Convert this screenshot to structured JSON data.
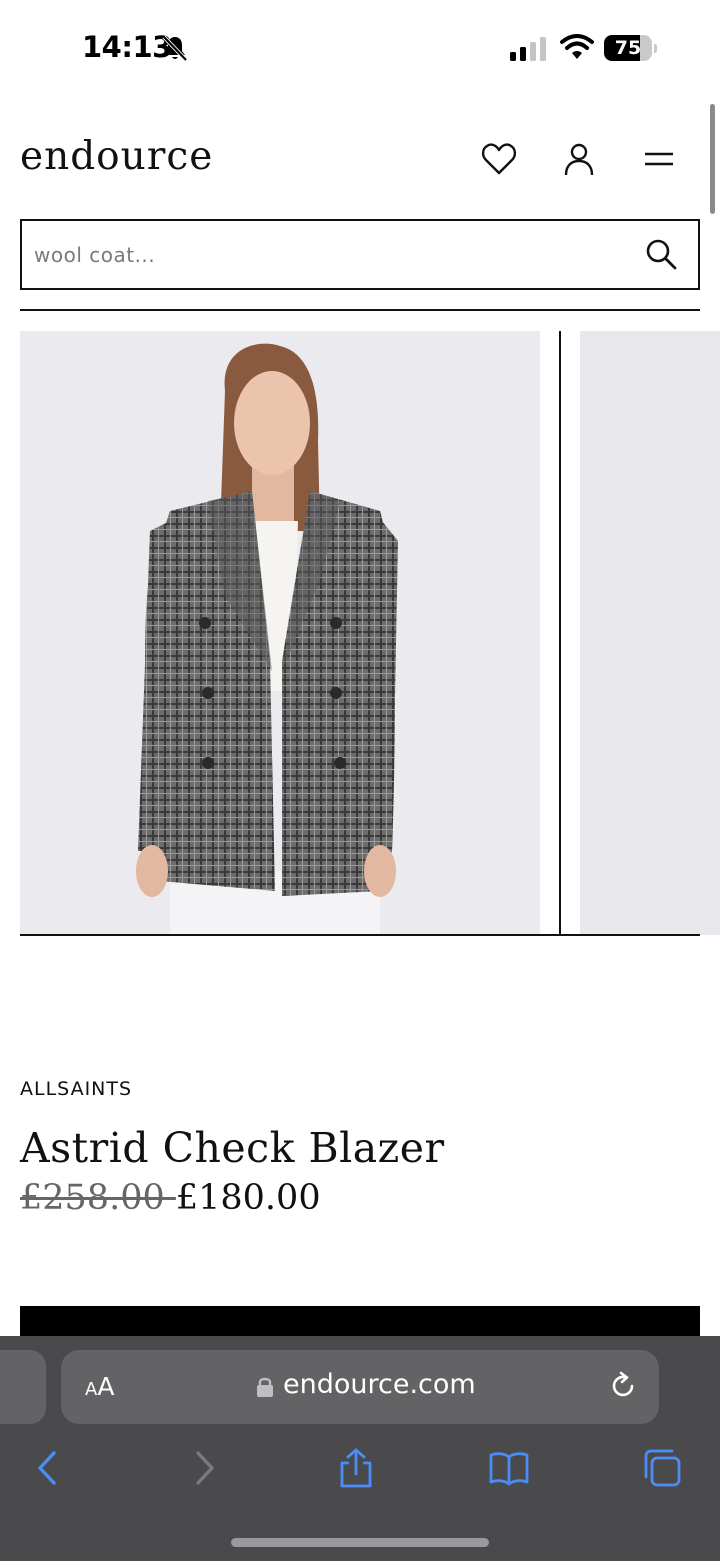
{
  "status_bar": {
    "time": "14:13",
    "battery_level": "75",
    "icons": [
      "bell-slash-icon",
      "cellular-signal-icon",
      "wifi-icon",
      "battery-icon"
    ]
  },
  "header": {
    "logo": "endource",
    "icons": [
      "heart-icon",
      "account-icon",
      "menu-icon"
    ]
  },
  "search": {
    "placeholder": "wool coat...",
    "value": "",
    "icon": "search-icon"
  },
  "product": {
    "brand": "ALLSAINTS",
    "name": "Astrid Check Blazer",
    "old_price": "£258.00",
    "new_price": "£180.00"
  },
  "browser": {
    "aa_small": "A",
    "aa_big": "A",
    "url": "endource.com",
    "toolbar_icons": [
      "back-icon",
      "forward-icon",
      "share-icon",
      "bookmarks-icon",
      "tabs-icon"
    ]
  },
  "colors": {
    "text": "#111111",
    "browser_chrome": "#4a4a4c",
    "browser_accent": "#4b8df8",
    "image_background": "#ebebef"
  }
}
